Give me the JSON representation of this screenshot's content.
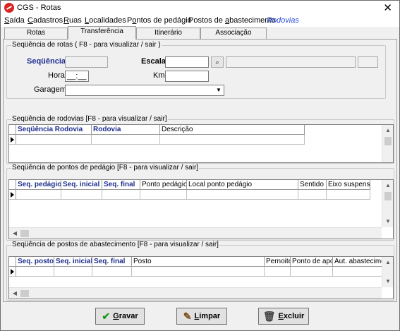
{
  "window": {
    "title": "CGS - Rotas",
    "close_glyph": "✕"
  },
  "menu": {
    "items": [
      {
        "label": "Saída",
        "accel": "S",
        "rest": "aída"
      },
      {
        "label": "Cadastros",
        "accel": "C",
        "rest": "adastros"
      },
      {
        "label": "Ruas",
        "accel": "R",
        "rest": "uas"
      },
      {
        "label": "Localidades",
        "accel": "L",
        "rest": "ocalidades"
      },
      {
        "label": "Pontos de pedágio",
        "pre": "P",
        "accel": "o",
        "rest": "ntos de pedágio"
      },
      {
        "label": "Postos de abastecimento",
        "pre": "Postos de ",
        "accel": "a",
        "rest": "bastecimento"
      },
      {
        "label": "Rodovias",
        "active": true
      }
    ]
  },
  "tabs": [
    {
      "label": "Rotas"
    },
    {
      "label": "Transferência",
      "selected": true
    },
    {
      "label": "Itinerário"
    },
    {
      "label": "Associação"
    }
  ],
  "route_sequence": {
    "legend": "Seqüência de rotas ( F8 - para visualizar / sair )",
    "sequencia_label": "Seqüência",
    "sequencia_value": "",
    "escala_label": "Escala",
    "escala_value": "",
    "escala_desc": "",
    "escala_extra": "",
    "hora_label": "Hora",
    "hora_value": "__:__",
    "km_label": "Km",
    "km_value": "",
    "garagem_label": "Garagem",
    "garagem_value": ""
  },
  "highways": {
    "legend": "Seqüência de rodovias [F8 - para visualizar / sair]",
    "columns": [
      "Seqüência Rodovia",
      "Rodovia",
      "Descrição"
    ]
  },
  "tolls": {
    "legend": "Seqüência de pontos de pedágio [F8 - para visualizar / sair]",
    "columns": [
      "Seq. pedágio",
      "Seq. inicial",
      "Seq. final",
      "Ponto pedágio",
      "Local ponto pedágio",
      "Sentido",
      "Eixo suspenso"
    ]
  },
  "stations": {
    "legend": "Seqüência de postos de abastecimento [F8 - para visualizar / sair]",
    "columns": [
      "Seq. posto",
      "Seq. inicial",
      "Seq. final",
      "Posto",
      "Pernoite",
      "Ponto de apoio",
      "Aut. abastecimento"
    ]
  },
  "buttons": {
    "save": {
      "label": "Gravar",
      "accel": "G",
      "rest": "ravar",
      "icon": "check-icon"
    },
    "clear": {
      "label": "Limpar",
      "accel": "L",
      "rest": "impar",
      "icon": "broom-icon"
    },
    "delete": {
      "label": "Excluir",
      "accel": "E",
      "rest": "xcluir",
      "icon": "trash-icon"
    }
  },
  "colors": {
    "active_menu": "#2648d8",
    "key_column": "#1e2f8f",
    "save_check": "#1a9a1a"
  }
}
